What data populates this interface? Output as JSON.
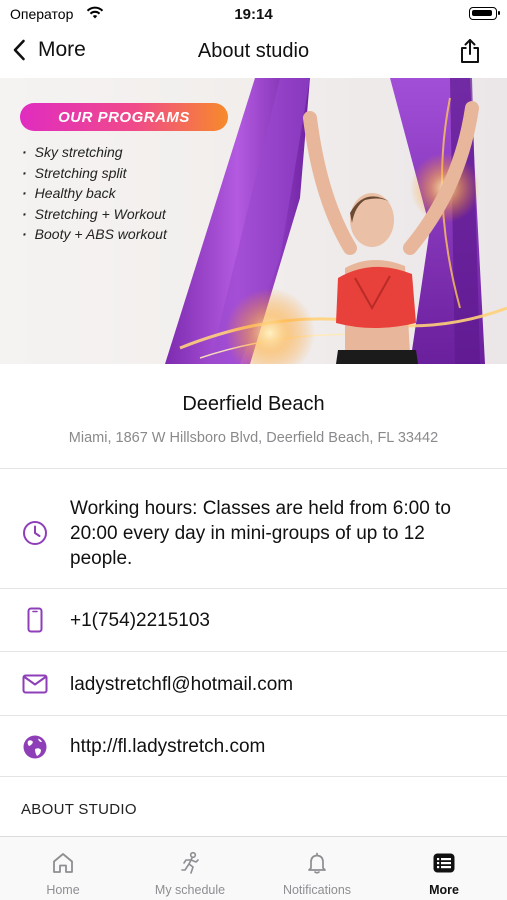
{
  "status_bar": {
    "carrier": "Оператор",
    "time": "19:14"
  },
  "nav": {
    "back_label": "More",
    "title": "About studio"
  },
  "hero": {
    "badge": "OUR PROGRAMS",
    "programs": [
      "Sky stretching",
      "Stretching split",
      "Healthy back",
      "Stretching + Workout",
      "Booty + ABS workout"
    ]
  },
  "studio": {
    "name": "Deerfield Beach",
    "address": "Miami, 1867 W Hillsboro Blvd, Deerfield Beach, FL 33442"
  },
  "contacts": {
    "hours": "Working hours: Classes are held from 6:00 to 20:00 every day in mini-groups of up to 12 people.",
    "phone": "+1(754)2215103",
    "email": "ladystretchfl@hotmail.com",
    "website": "http://fl.ladystretch.com"
  },
  "section_about": "ABOUT STUDIO",
  "tabs": [
    {
      "label": "Home",
      "icon": "home-icon"
    },
    {
      "label": "My schedule",
      "icon": "schedule-icon"
    },
    {
      "label": "Notifications",
      "icon": "bell-icon"
    },
    {
      "label": "More",
      "icon": "more-list-icon",
      "active": true
    }
  ],
  "colors": {
    "accent": "#8e3fb8",
    "badge_gradient": [
      "#e02cc0",
      "#f78a2a"
    ],
    "muted_text": "#8a8a8e"
  }
}
